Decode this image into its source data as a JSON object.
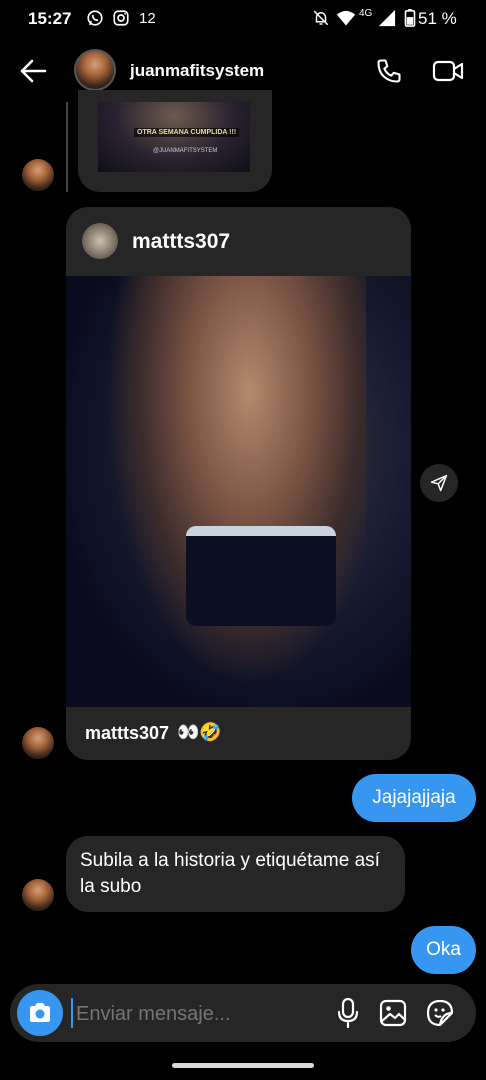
{
  "status_bar": {
    "time": "15:27",
    "notification_icons": [
      "whatsapp-icon",
      "instagram-icon"
    ],
    "notification_count": "12",
    "network": "4G",
    "battery": "51 %"
  },
  "header": {
    "username": "juanmafitsystem"
  },
  "thread": {
    "previous_shared_post_caption": "OTRA SEMANA CUMPLIDA !!!",
    "previous_shared_post_handle": "@JUANMAFITSYSTEM",
    "shared_post": {
      "author": "mattts307",
      "caption_author": "mattts307",
      "caption_text": "👀🤣"
    },
    "messages": [
      {
        "side": "out",
        "text": "Jajajajjaja"
      },
      {
        "side": "in",
        "text": "Subila a la historia y etiquétame así la subo"
      },
      {
        "side": "out",
        "text": "Oka"
      }
    ]
  },
  "composer": {
    "placeholder": "Enviar mensaje..."
  },
  "colors": {
    "background": "#000000",
    "incoming_bubble": "#262626",
    "outgoing_bubble": "#3797f0",
    "camera_button": "#3797f0"
  }
}
